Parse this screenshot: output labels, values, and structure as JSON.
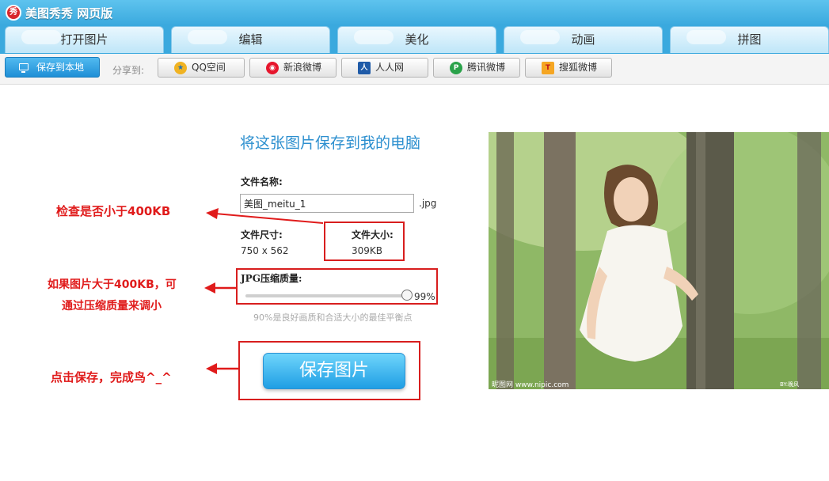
{
  "app": {
    "logo_text": "秀",
    "title": "美图秀秀 网页版"
  },
  "tabs": [
    {
      "label": "打开图片"
    },
    {
      "label": "编辑"
    },
    {
      "label": "美化"
    },
    {
      "label": "动画"
    },
    {
      "label": "拼图"
    }
  ],
  "toolbar": {
    "save_local": "保存到本地",
    "share_label": "分享到:",
    "share": [
      {
        "label": "QQ空间",
        "icon": "qzone-icon"
      },
      {
        "label": "新浪微博",
        "icon": "weibo-icon"
      },
      {
        "label": "人人网",
        "icon": "renren-icon"
      },
      {
        "label": "腾讯微博",
        "icon": "tencent-weibo-icon"
      },
      {
        "label": "搜狐微博",
        "icon": "sohu-weibo-icon"
      }
    ]
  },
  "main": {
    "heading": "将这张图片保存到我的电脑",
    "filename_label": "文件名称:",
    "filename_value": "美图_meitu_1",
    "filename_ext": ".jpg",
    "dimensions_label": "文件尺寸:",
    "dimensions_value": "750 x 562",
    "filesize_label": "文件大小:",
    "filesize_value": "309KB",
    "quality_label": "JPG压缩质量:",
    "quality_value": "99%",
    "quality_level": 0.99,
    "quality_hint": "90%是良好画质和合适大小的最佳平衡点",
    "save_button": "保存图片"
  },
  "annotations": {
    "check_size": "检查是否小于400KB",
    "compress_line1": "如果图片大于400KB，可",
    "compress_line2": "通过压缩质量来调小",
    "click_save": "点击保存，完成鸟^_^"
  },
  "photo": {
    "watermark_left": "昵图网 www.nipic.com",
    "watermark_right": "BY:晚风 No:2012..."
  },
  "colors": {
    "accent": "#2c8fcf",
    "annotation_red": "#e01b1b",
    "tab_bar": "#3aa9de"
  }
}
